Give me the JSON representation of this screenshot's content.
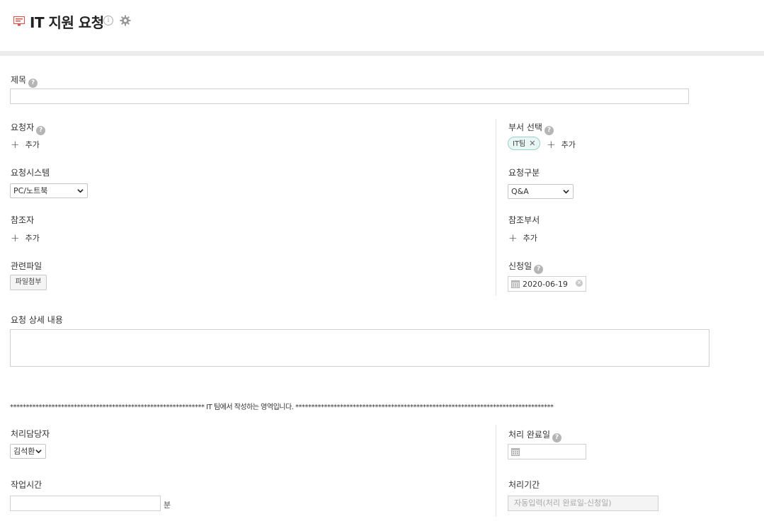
{
  "header": {
    "title": "IT 지원 요청",
    "info_icon_glyph": "i"
  },
  "fields": {
    "title_label": "제목",
    "requester_label": "요청자",
    "requester_add": "추가",
    "dept_label": "부서 선택",
    "dept_tag": "IT팀",
    "dept_add": "추가",
    "system_label": "요청시스템",
    "system_value": "PC/노트북",
    "category_label": "요청구분",
    "category_value": "Q&A",
    "cc_label": "참조자",
    "cc_add": "추가",
    "cc_dept_label": "참조부서",
    "cc_dept_add": "추가",
    "file_label": "관련파일",
    "file_button": "파일첨부",
    "apply_date_label": "신청일",
    "apply_date_value": "2020-06-19",
    "detail_label": "요청 상세 내용"
  },
  "it_section": {
    "separator": "************************************************************* IT 팀에서 작성하는 영역입니다. *********************************************************************************",
    "handler_label": "처리담당자",
    "handler_value": "김석환",
    "done_date_label": "처리 완료일",
    "work_time_label": "작업시간",
    "work_time_unit": "분",
    "period_label": "처리기간",
    "period_placeholder": "자동입력(처리 완료일-신청일)"
  },
  "colors": {
    "tag_border": "#9cd0cb",
    "tag_bg": "#e8f6f4",
    "help_icon": "#b5b5b5",
    "app_icon": "#d9534f"
  }
}
